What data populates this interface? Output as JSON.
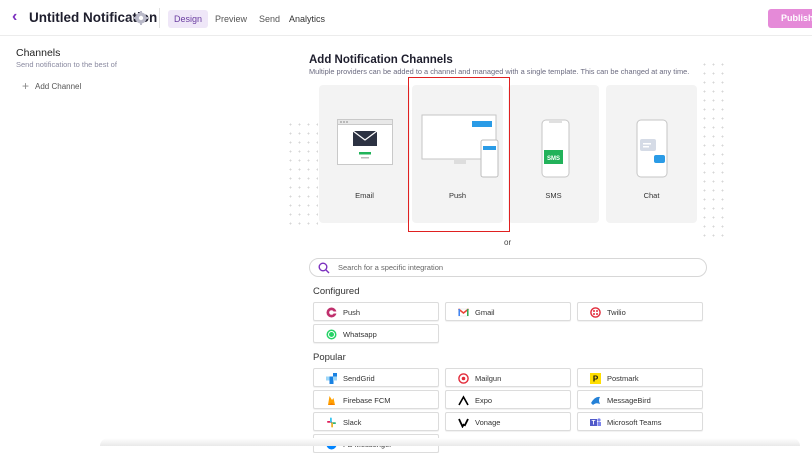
{
  "header": {
    "title": "Untitled Notification",
    "tabs": [
      {
        "label": "Design"
      },
      {
        "label": "Preview"
      },
      {
        "label": "Send"
      },
      {
        "label": "Analytics"
      }
    ],
    "publish_label": "Publish"
  },
  "sidebar": {
    "title": "Channels",
    "subtitle": "Send notification to the best of",
    "add_channel": "Add Channel"
  },
  "main": {
    "title": "Add Notification Channels",
    "subtitle": "Multiple providers can be added to a channel and managed with a single template. This can be changed at any time.",
    "channels": [
      {
        "label": "Email",
        "icon": "email-illustration"
      },
      {
        "label": "Push",
        "icon": "push-illustration"
      },
      {
        "label": "SMS",
        "icon": "sms-illustration"
      },
      {
        "label": "Chat",
        "icon": "chat-illustration"
      }
    ],
    "or_label": "or",
    "search_placeholder": "Search for a specific integration",
    "configured_title": "Configured",
    "configured": [
      {
        "label": "Push",
        "icon": "courier-push-icon",
        "color": "#c0306d"
      },
      {
        "label": "Gmail",
        "icon": "gmail-icon",
        "color": "#ea4335"
      },
      {
        "label": "Twilio",
        "icon": "twilio-icon",
        "color": "#e22b3a"
      },
      {
        "label": "Whatsapp",
        "icon": "whatsapp-icon",
        "color": "#25d366"
      }
    ],
    "popular_title": "Popular",
    "popular": [
      {
        "label": "SendGrid",
        "icon": "sendgrid-icon",
        "color": "#1a82e2"
      },
      {
        "label": "Mailgun",
        "icon": "mailgun-icon",
        "color": "#e22b3a"
      },
      {
        "label": "Postmark",
        "icon": "postmark-icon",
        "color": "#ffde00"
      },
      {
        "label": "Firebase FCM",
        "icon": "firebase-icon",
        "color": "#ffa000"
      },
      {
        "label": "Expo",
        "icon": "expo-icon",
        "color": "#000000"
      },
      {
        "label": "MessageBird",
        "icon": "messagebird-icon",
        "color": "#2481d7"
      },
      {
        "label": "Slack",
        "icon": "slack-icon",
        "color": "#4a154b"
      },
      {
        "label": "Vonage",
        "icon": "vonage-icon",
        "color": "#000000"
      },
      {
        "label": "Microsoft Teams",
        "icon": "teams-icon",
        "color": "#5059c9"
      },
      {
        "label": "FB Messenger",
        "icon": "messenger-icon",
        "color": "#0084ff"
      }
    ]
  },
  "colors": {
    "accent": "#7b2fbe",
    "publish": "#e58ad8",
    "selection": "#e02020"
  }
}
